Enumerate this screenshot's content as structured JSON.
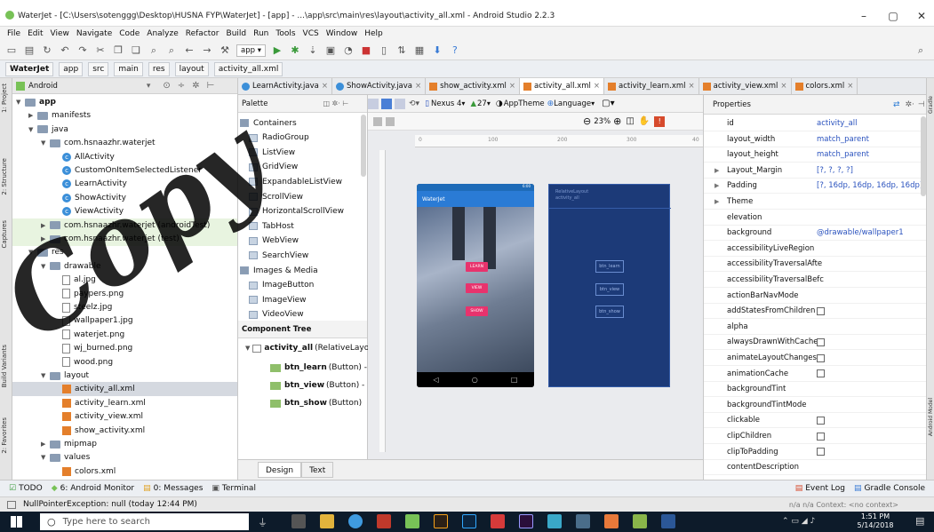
{
  "window": {
    "title": "WaterJet - [C:\\Users\\sotenggg\\Desktop\\HUSNA FYP\\WaterJet] - [app] - ...\\app\\src\\main\\res\\layout\\activity_all.xml - Android Studio 2.2.3",
    "minimize": "–",
    "maximize": "▢",
    "close": "✕"
  },
  "menu": [
    "File",
    "Edit",
    "View",
    "Navigate",
    "Code",
    "Analyze",
    "Refactor",
    "Build",
    "Run",
    "Tools",
    "VCS",
    "Window",
    "Help"
  ],
  "toolbar": {
    "run_config": "app"
  },
  "breadcrumbs": [
    "WaterJet",
    "app",
    "src",
    "main",
    "res",
    "layout",
    "activity_all.xml"
  ],
  "project": {
    "view_mode": "Android",
    "tree": [
      {
        "label": "app",
        "kind": "folder",
        "level": 0,
        "open": true
      },
      {
        "label": "manifests",
        "kind": "folder",
        "level": 1
      },
      {
        "label": "java",
        "kind": "folder",
        "level": 1,
        "open": true
      },
      {
        "label": "com.hsnaazhr.waterjet",
        "kind": "folder",
        "level": 2,
        "open": true
      },
      {
        "label": "AllActivity",
        "kind": "class",
        "level": 3
      },
      {
        "label": "CustomOnItemSelectedListener",
        "kind": "class",
        "level": 3
      },
      {
        "label": "LearnActivity",
        "kind": "class",
        "level": 3
      },
      {
        "label": "ShowActivity",
        "kind": "class",
        "level": 3
      },
      {
        "label": "ViewActivity",
        "kind": "class",
        "level": 3
      },
      {
        "label": "com.hsnaazhr.waterjet (androidTest)",
        "kind": "folder",
        "level": 2,
        "green": true
      },
      {
        "label": "com.hsnaazhr.waterjet (test)",
        "kind": "folder",
        "level": 2,
        "green": true
      },
      {
        "label": "res",
        "kind": "folder",
        "level": 1,
        "open": true
      },
      {
        "label": "drawable",
        "kind": "folder",
        "level": 2,
        "open": true
      },
      {
        "label": "al.jpg",
        "kind": "file",
        "level": 3
      },
      {
        "label": "paypers.png",
        "kind": "file",
        "level": 3
      },
      {
        "label": "steelz.jpg",
        "kind": "file",
        "level": 3
      },
      {
        "label": "wallpaper1.jpg",
        "kind": "file",
        "level": 3
      },
      {
        "label": "waterjet.png",
        "kind": "file",
        "level": 3
      },
      {
        "label": "wj_burned.png",
        "kind": "file",
        "level": 3
      },
      {
        "label": "wood.png",
        "kind": "file",
        "level": 3
      },
      {
        "label": "layout",
        "kind": "folder",
        "level": 2,
        "open": true
      },
      {
        "label": "activity_all.xml",
        "kind": "xml",
        "level": 3,
        "selected": true
      },
      {
        "label": "activity_learn.xml",
        "kind": "xml",
        "level": 3
      },
      {
        "label": "activity_view.xml",
        "kind": "xml",
        "level": 3
      },
      {
        "label": "show_activity.xml",
        "kind": "xml",
        "level": 3
      },
      {
        "label": "mipmap",
        "kind": "folder",
        "level": 2
      },
      {
        "label": "values",
        "kind": "folder",
        "level": 2,
        "open": true
      },
      {
        "label": "colors.xml",
        "kind": "xml",
        "level": 3
      }
    ]
  },
  "side_tabs": {
    "left": [
      "1: Project",
      "2: Structure",
      "Captures",
      "Build Variants",
      "2: Favorites"
    ],
    "right": [
      "Gradle",
      "Android Model"
    ]
  },
  "editor_tabs": [
    {
      "label": "LearnActivity.java",
      "kind": "java"
    },
    {
      "label": "ShowActivity.java",
      "kind": "java"
    },
    {
      "label": "show_activity.xml",
      "kind": "xml"
    },
    {
      "label": "activity_all.xml",
      "kind": "xml",
      "active": true
    },
    {
      "label": "activity_learn.xml",
      "kind": "xml"
    },
    {
      "label": "activity_view.xml",
      "kind": "xml"
    },
    {
      "label": "colors.xml",
      "kind": "xml"
    }
  ],
  "palette": {
    "title": "Palette",
    "items": [
      {
        "label": "Containers",
        "group": true
      },
      {
        "label": "RadioGroup"
      },
      {
        "label": "ListView"
      },
      {
        "label": "GridView"
      },
      {
        "label": "ExpandableListView"
      },
      {
        "label": "ScrollView"
      },
      {
        "label": "HorizontalScrollView"
      },
      {
        "label": "TabHost"
      },
      {
        "label": "WebView"
      },
      {
        "label": "SearchView"
      },
      {
        "label": "Images & Media",
        "group": true
      },
      {
        "label": "ImageButton"
      },
      {
        "label": "ImageView"
      },
      {
        "label": "VideoView"
      }
    ]
  },
  "design_toolbar": {
    "device": "Nexus 4",
    "api": "27",
    "theme": "AppTheme",
    "language": "Language",
    "zoom": "23%"
  },
  "ruler": {
    "ticks": [
      "0",
      "100",
      "200",
      "300",
      "40"
    ]
  },
  "preview": {
    "app_title": "WaterJet",
    "status_time": "6:00",
    "buttons": [
      "LEARN",
      "VIEW",
      "SHOW"
    ]
  },
  "blueprint": {
    "label": "RelativeLayout",
    "sub": "activity_all",
    "buttons": [
      "btn_learn",
      "btn_view",
      "btn_show"
    ]
  },
  "component_tree": {
    "title": "Component Tree",
    "root": "activity_all",
    "root_type": "(RelativeLayout)",
    "children": [
      {
        "id": "btn_learn",
        "type": "(Button) -"
      },
      {
        "id": "btn_view",
        "type": "(Button) -"
      },
      {
        "id": "btn_show",
        "type": "(Button)"
      }
    ]
  },
  "design_tabs": [
    "Design",
    "Text"
  ],
  "properties": {
    "title": "Properties",
    "rows": [
      {
        "k": "id",
        "v": "activity_all"
      },
      {
        "k": "layout_width",
        "v": "match_parent"
      },
      {
        "k": "layout_height",
        "v": "match_parent"
      },
      {
        "k": "Layout_Margin",
        "v": "[?, ?, ?, ?]",
        "expand": true
      },
      {
        "k": "Padding",
        "v": "[?, 16dp, 16dp, 16dp, 16dp]",
        "expand": true
      },
      {
        "k": "Theme",
        "v": "",
        "expand": true
      },
      {
        "k": "elevation",
        "v": ""
      },
      {
        "k": "background",
        "v": "@drawable/wallpaper1"
      },
      {
        "k": "accessibilityLiveRegion",
        "v": ""
      },
      {
        "k": "accessibilityTraversalAfte",
        "v": ""
      },
      {
        "k": "accessibilityTraversalBefc",
        "v": ""
      },
      {
        "k": "actionBarNavMode",
        "v": ""
      },
      {
        "k": "addStatesFromChildren",
        "v": "",
        "checkbox": true
      },
      {
        "k": "alpha",
        "v": ""
      },
      {
        "k": "alwaysDrawnWithCache",
        "v": "",
        "checkbox": true
      },
      {
        "k": "animateLayoutChanges",
        "v": "",
        "checkbox": true
      },
      {
        "k": "animationCache",
        "v": "",
        "checkbox": true
      },
      {
        "k": "backgroundTint",
        "v": ""
      },
      {
        "k": "backgroundTintMode",
        "v": ""
      },
      {
        "k": "clickable",
        "v": "",
        "checkbox": true
      },
      {
        "k": "clipChildren",
        "v": "",
        "checkbox": true
      },
      {
        "k": "clipToPadding",
        "v": "",
        "checkbox": true
      },
      {
        "k": "contentDescription",
        "v": ""
      }
    ]
  },
  "bottom_tools": {
    "left": [
      "TODO",
      "6: Android Monitor",
      "0: Messages",
      "Terminal"
    ],
    "right": [
      "Event Log",
      "Gradle Console"
    ]
  },
  "status": {
    "message": "NullPointerException: null (today 12:44 PM)",
    "right": "n/a   n/a   Context: <no context>"
  },
  "taskbar": {
    "search_placeholder": "Type here to search",
    "time": "1:51 PM",
    "date": "5/14/2018"
  },
  "watermark": "Copy"
}
